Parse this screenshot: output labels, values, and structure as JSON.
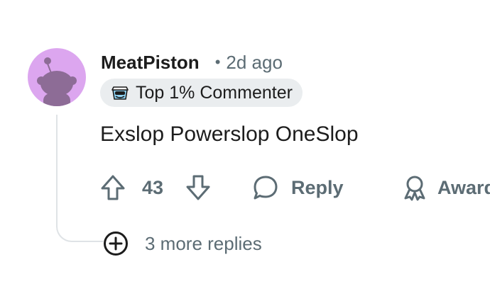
{
  "comment": {
    "username": "MeatPiston",
    "separator": "•",
    "timestamp": "2d ago",
    "flair": {
      "icon": "top-commenter-badge-icon",
      "label": "Top 1% Commenter"
    },
    "body": "Exslop Powerslop OneSlop",
    "score": "43",
    "reply_label": "Reply",
    "award_label": "Award",
    "more_replies_label": "3 more replies"
  },
  "colors": {
    "avatar_bg": "#dca6ef",
    "muted_text": "#5c6c74",
    "flair_bg": "#eaedef",
    "thread_line": "#dfe3e6"
  }
}
